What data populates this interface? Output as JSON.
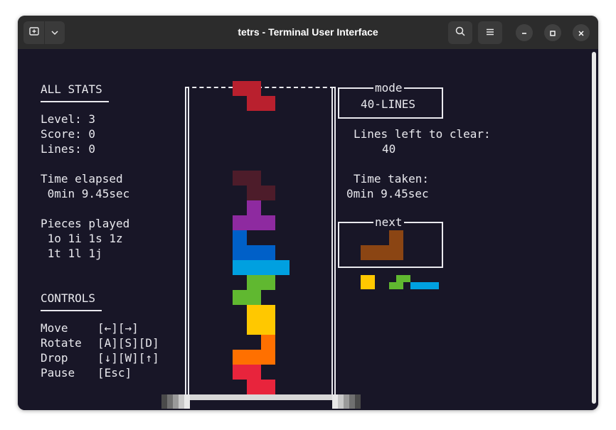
{
  "window": {
    "title": "tetrs - Terminal User Interface"
  },
  "stats": {
    "heading": "ALL STATS",
    "level": "Level: 3",
    "score": "Score: 0",
    "lines": "Lines: 0",
    "time_label": "Time elapsed",
    "time_value": " 0min 9.45sec",
    "pieces_label": "Pieces played",
    "pieces_row1": " 1o 1i 1s 1z",
    "pieces_row2": " 1t 1l 1j"
  },
  "controls": {
    "heading": "CONTROLS",
    "rows": [
      {
        "action": "Move",
        "keys": "[←][→]"
      },
      {
        "action": "Rotate",
        "keys": "[A][S][D]"
      },
      {
        "action": "Drop",
        "keys": "[↓][W][↑]"
      },
      {
        "action": "Pause",
        "keys": "[Esc]"
      }
    ]
  },
  "mode": {
    "box_title": "mode",
    "value": "40-LINES",
    "lines_left_label": "Lines left to clear:",
    "lines_left_value": "40",
    "time_taken_label": "Time taken:",
    "time_taken_value": "0min 9.45sec"
  },
  "next": {
    "box_title": "next"
  },
  "colors": {
    "background": "#181627",
    "z_red": "#b9202e",
    "ghost_dark": "#4d1c2a",
    "t_purple": "#8e2aa0",
    "j_blue": "#0060c8",
    "i_cyan": "#00a0e0",
    "s_green": "#60b830",
    "o_yellow": "#ffc800",
    "l_orange": "#ff7000",
    "z2_red": "#e8243c",
    "next_l_brown": "#8b4513"
  }
}
